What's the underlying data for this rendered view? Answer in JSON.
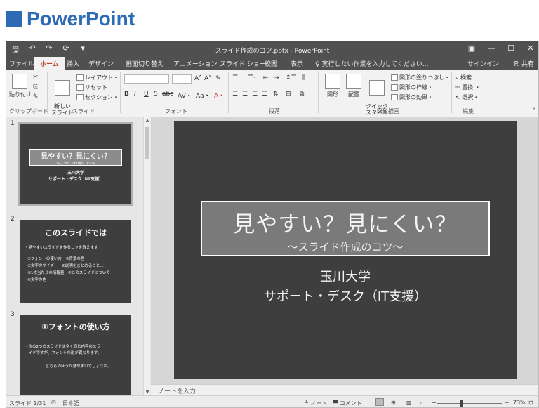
{
  "heading": {
    "text": "PowerPoint"
  },
  "window": {
    "qat": [
      "🖫",
      "↶",
      "↷",
      "⟳",
      "▾"
    ],
    "title": "スライド作成のコツ.pptx - PowerPoint",
    "controls": [
      "▣",
      "—",
      "☐",
      "✕"
    ]
  },
  "tabs": [
    "ファイル",
    "ホーム",
    "挿入",
    "デザイン",
    "画面切り替え",
    "アニメーション",
    "スライド ショー",
    "校閲",
    "表示"
  ],
  "tellme": "♀ 実行したい作業を入力してください...",
  "signin": "サインイン",
  "share": "Ｒ 共有",
  "ribbon": {
    "clipboard": {
      "paste": "貼り付け",
      "label": "クリップボード"
    },
    "slides": {
      "new_slide": "新しい\nスライド",
      "layout": "レイアウト・",
      "reset": "リセット",
      "section": "セクション・",
      "label": "スライド"
    },
    "font": {
      "bold": "B",
      "italic": "I",
      "underline": "U",
      "shadow": "S",
      "strike": "abc",
      "spacing": "AV・",
      "case": "Aa・",
      "color": "A・",
      "grow": "A˄",
      "shrink": "A˅",
      "clear": "✎",
      "label": "フォント"
    },
    "paragraph": {
      "label": "段落"
    },
    "drawing": {
      "shape": "図形",
      "arrange": "配置",
      "quick_style": "クイック\nスタイル",
      "fill": "図形の塗りつぶし・",
      "outline": "図形の枠線・",
      "effect": "図形の効果・",
      "label": "図形描画"
    },
    "editing": {
      "find": "検索",
      "replace": "置換 ・",
      "select": "選択・",
      "label": "編集"
    }
  },
  "thumbnails": [
    {
      "num": "1",
      "title": "見やすい？見にくい？",
      "subtitle": "〜スライド作成のコツ〜",
      "org1": "玉川大学",
      "org2": "サポート・デスク（IT支援）"
    },
    {
      "num": "2",
      "heading": "このスライドでは",
      "lines": [
        "・見やすいスライドを作るコツを教えます",
        "①フォントの使い方　⑤背景の色",
        "②文字のサイズ　　⑥説明をまとめること…",
        "③1枚当たりの情報量　⑦このスライドについて",
        "④文字の色"
      ]
    },
    {
      "num": "3",
      "heading": "①フォントの使い方",
      "lines": [
        "・次の2つのスライドは全く同じ内容のスラ",
        "　イドですが、フォントの形が異なります。",
        "どちらのほうが見やすいでしょうか。"
      ]
    }
  ],
  "slide": {
    "title": "見やすい？見にくい？",
    "subtitle": "〜スライド作成のコツ〜",
    "org1": "玉川大学",
    "org2": "サポート・デスク（IT支援）"
  },
  "notes_placeholder": "ノートを入力",
  "status": {
    "slide_count": "スライド 1/31",
    "language": "日本語",
    "notes": "≜ ノート",
    "comments": "▀ コメント",
    "zoom": "73%",
    "zoom_level": 0.73
  }
}
